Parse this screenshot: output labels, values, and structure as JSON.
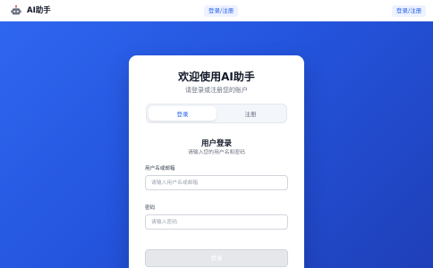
{
  "header": {
    "brand_name": "AI助手",
    "brand_icon": "robot-icon",
    "center_button_label": "登录/注册",
    "right_button_label": "登录/注册"
  },
  "login_card": {
    "title": "欢迎使用AI助手",
    "subtitle": "请登录或注册您的账户",
    "tabs": [
      {
        "label": "登录",
        "active": true
      },
      {
        "label": "注册",
        "active": false
      }
    ],
    "section_title": "用户登录",
    "section_subtitle": "请输入您的用户名和密码",
    "username_label": "用户名或邮箱",
    "username_placeholder": "请输入用户名或邮箱",
    "username_value": "",
    "password_label": "密码",
    "password_placeholder": "请输入密码",
    "password_value": "",
    "submit_label": "登录"
  },
  "colors": {
    "background_gradient_start": "#2f66f0",
    "background_gradient_end": "#1f3fb8",
    "accent": "#2563eb",
    "submit_disabled": "#e5e7eb"
  }
}
